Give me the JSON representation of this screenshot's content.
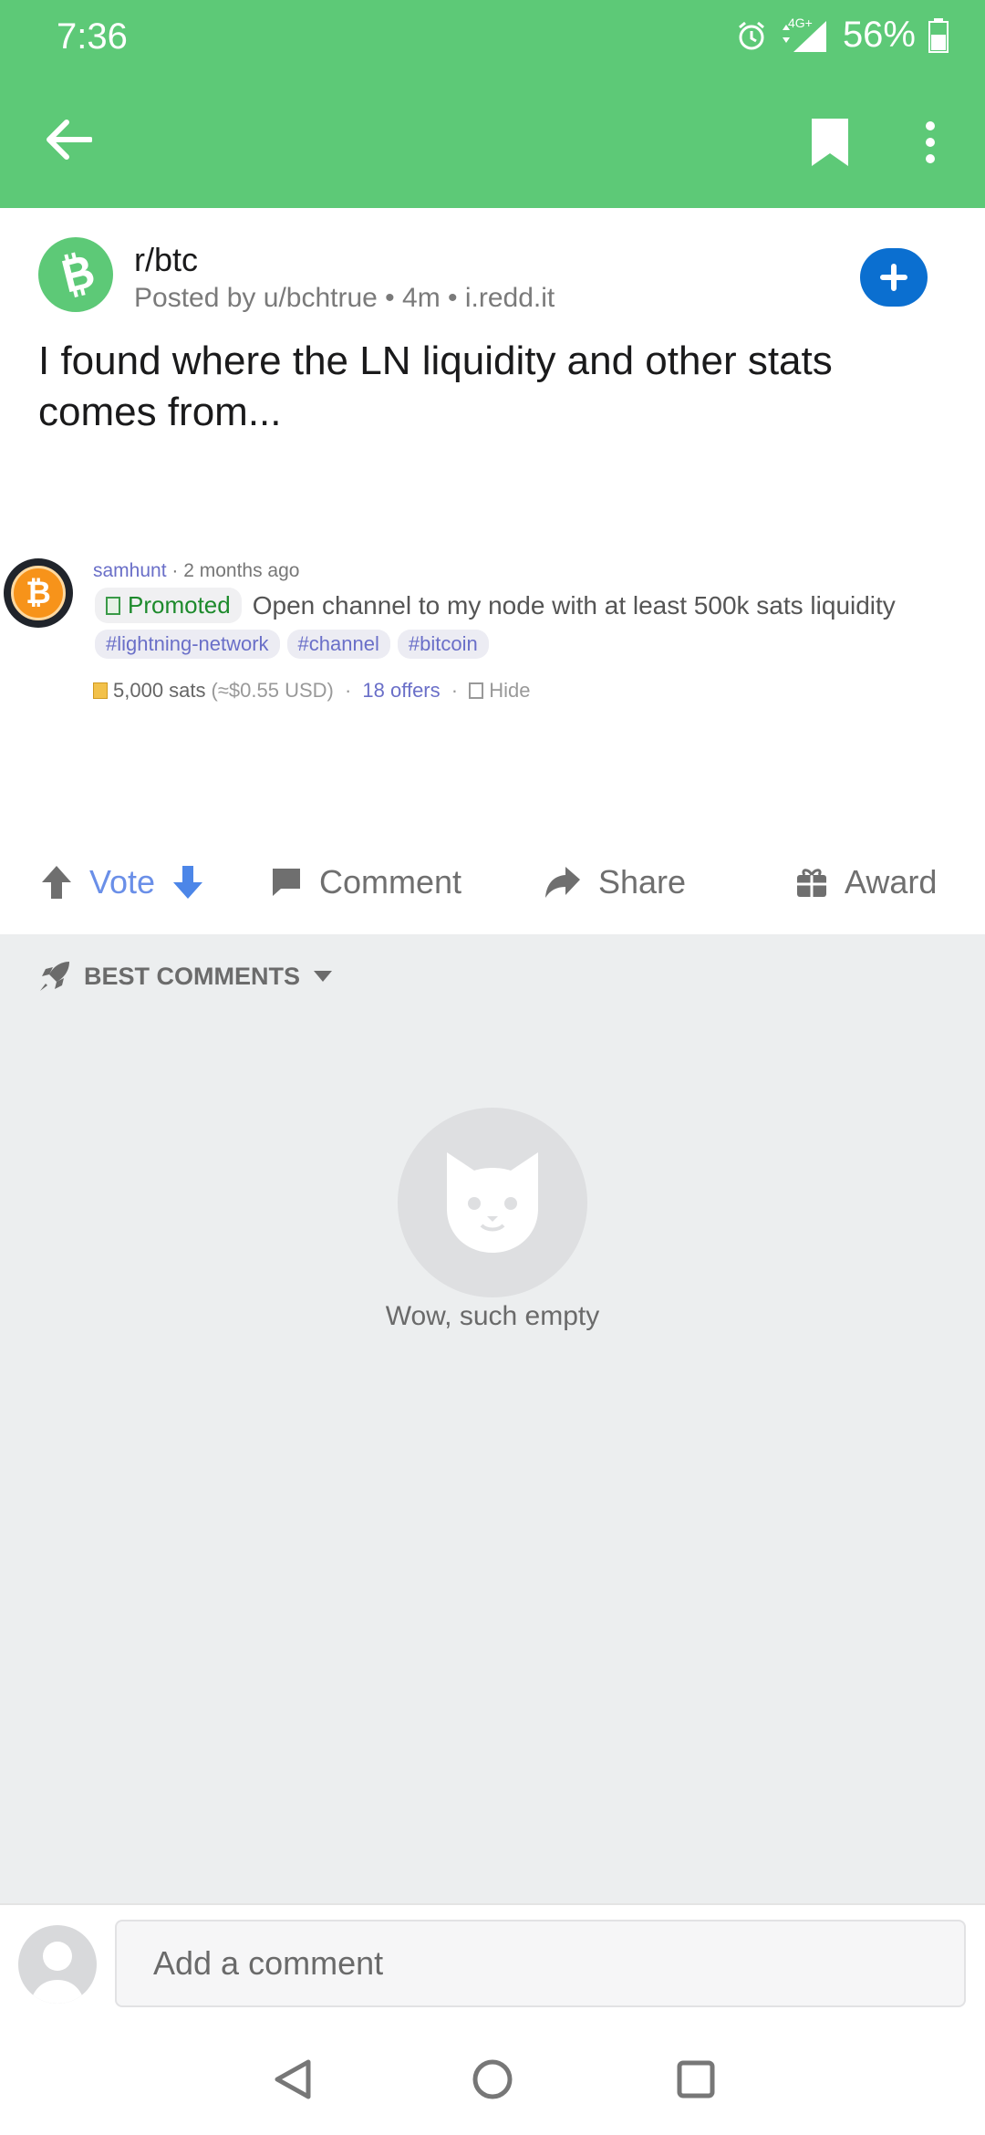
{
  "status": {
    "time": "7:36",
    "network": "4G+",
    "battery": "56%"
  },
  "subreddit": {
    "name": "r/btc",
    "meta": "Posted by u/bchtrue • 4m • i.redd.it"
  },
  "post": {
    "title": "I found where the LN liquidity and other stats comes from..."
  },
  "embed": {
    "user": "samhunt",
    "time": "2 months ago",
    "badge": "Promoted",
    "description": "Open channel to my node with at least 500k sats liquidity",
    "tags": [
      "#lightning-network",
      "#channel",
      "#bitcoin"
    ],
    "amount": "5,000 sats",
    "usd": "(≈$0.55 USD)",
    "offers": "18 offers",
    "hide": "Hide"
  },
  "actions": {
    "vote": "Vote",
    "comment": "Comment",
    "share": "Share",
    "award": "Award"
  },
  "comments": {
    "sort_label": "BEST COMMENTS",
    "empty": "Wow, such empty"
  },
  "composer": {
    "placeholder": "Add a comment"
  },
  "colors": {
    "header": "#5dc977",
    "join": "#0b6fd0",
    "vote": "#6a8fe8"
  }
}
